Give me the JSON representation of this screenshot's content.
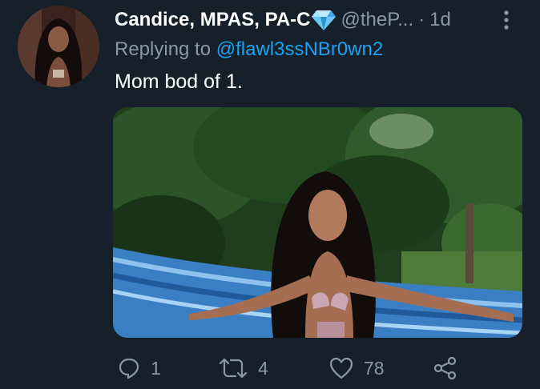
{
  "tweet": {
    "display_name": "Candice, MPAS, PA-C",
    "handle": "@theP...",
    "separator": "·",
    "time": "1d",
    "reply_prefix": "Replying to",
    "reply_to": "@flawl3ssNBr0wn2",
    "text": "Mom bod of 1.",
    "media_alt": "photo",
    "name_emoji": "gem-stone-icon"
  },
  "actions": {
    "reply_count": "1",
    "retweet_count": "4",
    "like_count": "78"
  },
  "colors": {
    "background": "#15202b",
    "text_primary": "#ffffff",
    "text_secondary": "#8899a6",
    "link": "#1da1f2"
  },
  "icons": [
    "more-vertical-icon",
    "reply-icon",
    "retweet-icon",
    "heart-icon",
    "share-icon"
  ]
}
